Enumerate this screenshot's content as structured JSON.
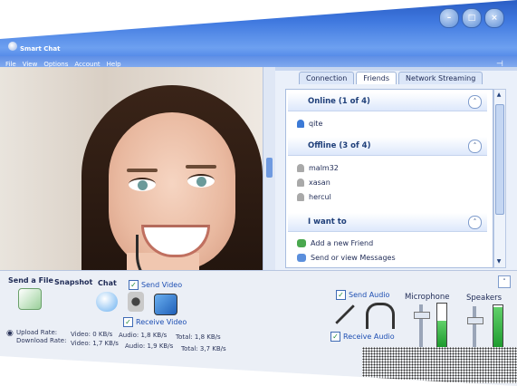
{
  "window": {
    "title": "Smart Chat",
    "min_glyph": "–",
    "max_glyph": "□",
    "close_glyph": "×"
  },
  "menu": {
    "items": [
      "File",
      "View",
      "Options",
      "Account",
      "Help"
    ]
  },
  "tabs": [
    {
      "label": "Connection",
      "active": false
    },
    {
      "label": "Friends",
      "active": true
    },
    {
      "label": "Network Streaming",
      "active": false
    }
  ],
  "groups": {
    "online": {
      "title": "Online (1 of 4)",
      "users": [
        "qite"
      ]
    },
    "offline": {
      "title": "Offline (3 of 4)",
      "users": [
        "malm32",
        "xasan",
        "hercul"
      ]
    },
    "iwant": {
      "title": "I want to",
      "actions": [
        "Add a new Friend",
        "Send or view Messages"
      ]
    }
  },
  "collapse_glyph": "˄",
  "bottom": {
    "send_file": "Send a File",
    "snapshot": "Snapshot",
    "chat": "Chat",
    "send_video": "Send Video",
    "receive_video": "Receive Video",
    "send_audio": "Send Audio",
    "receive_audio": "Receive Audio",
    "microphone": "Microphone",
    "speakers": "Speakers",
    "check_glyph": "✓"
  },
  "status": {
    "upload_label": "Upload Rate:",
    "download_label": "Download Rate:",
    "up_video": "Video: 0 KB/s",
    "up_audio": "Audio: 1,8 KB/s",
    "up_total": "Total: 1,8 KB/s",
    "down_video": "Video: 1,7 KB/s",
    "down_audio": "Audio: 1,9 KB/s",
    "down_total": "Total: 3,7 KB/s"
  },
  "levels": {
    "microphone": 0.6,
    "speakers": 0.95
  },
  "colors": {
    "accent": "#2a5dc4",
    "meter": "#1c9a2d"
  }
}
